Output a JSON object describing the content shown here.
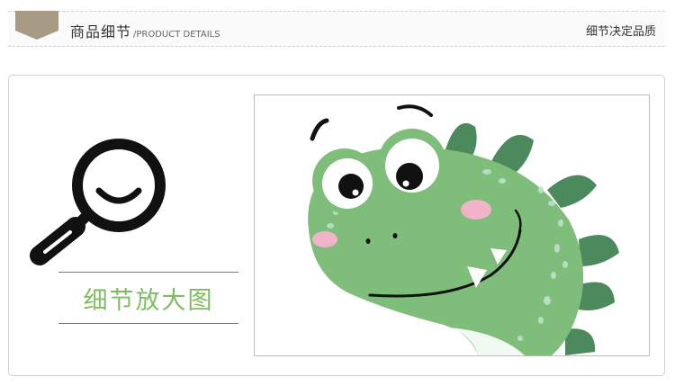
{
  "header": {
    "title": "商品细节",
    "subtitle": "/PRODUCT DETAILS",
    "slogan": "细节决定品质"
  },
  "detail": {
    "label": "细节放大图"
  },
  "icons": {
    "header_tag": "pennant-tag-icon",
    "magnifier": "magnifier-icon",
    "photo": "dinosaur-illustration"
  },
  "colors": {
    "tag": "#a79b83",
    "label_green": "#7fbd63",
    "dino_green": "#7fbd7a",
    "dino_spikes": "#4c8a5e"
  }
}
